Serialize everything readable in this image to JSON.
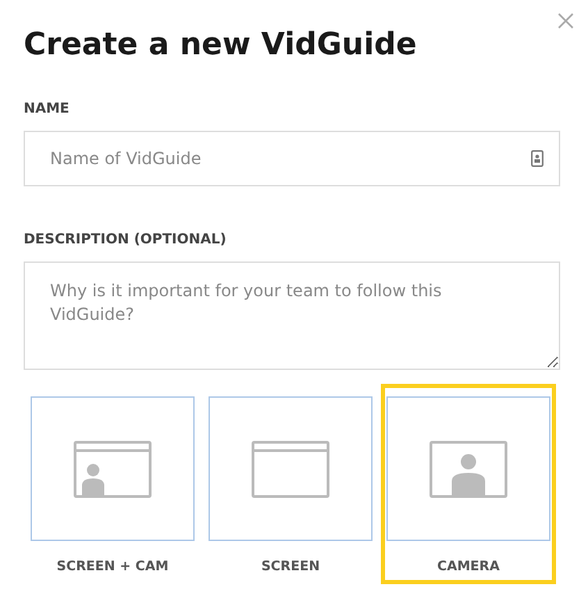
{
  "dialog": {
    "title": "Create a new VidGuide"
  },
  "name_field": {
    "label": "NAME",
    "placeholder": "Name of VidGuide"
  },
  "description_field": {
    "label": "DESCRIPTION (OPTIONAL)",
    "placeholder": "Why is it important for your team to follow this VidGuide?"
  },
  "modes": [
    {
      "kind": "screen_cam",
      "label": "SCREEN + CAM",
      "selected": false
    },
    {
      "kind": "screen",
      "label": "SCREEN",
      "selected": false
    },
    {
      "kind": "camera",
      "label": "CAMERA",
      "selected": true
    }
  ]
}
